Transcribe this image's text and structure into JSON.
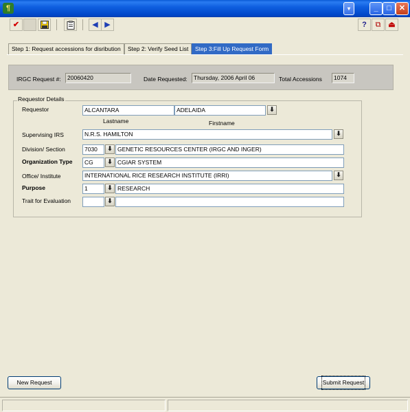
{
  "titlebar": {
    "app_icon": "rice-plant-icon",
    "buttons": {
      "system": "▾",
      "minimize": "_",
      "maximize": "□",
      "close": "✕"
    }
  },
  "toolbar": {
    "check": "✔",
    "save": "💾",
    "clipboard": "📋",
    "prev": "◀",
    "next": "▶",
    "help": "?",
    "copy": "⧉",
    "exit": "⏏"
  },
  "tabs": [
    {
      "label": "Step 1: Request accessions for disribution"
    },
    {
      "label": "Step 2: Verify Seed List"
    },
    {
      "label": "Step 3:Fill Up Request Form"
    }
  ],
  "header": {
    "request_label": "IRGC Request #:",
    "request_value": "20060420",
    "date_label": "Date Requested:",
    "date_value": "Thursday, 2006 April 06",
    "total_label": "Total Accessions",
    "total_value": "1074"
  },
  "requestor": {
    "group_title": "Requestor Details",
    "requestor_label": "Requestor",
    "lastname": "ALCANTARA",
    "firstname": "ADELAIDA",
    "lastname_label": "Lastname",
    "firstname_label": "Firstname",
    "irs_label": "Supervising IRS",
    "irs_value": "N.R.S. HAMILTON",
    "division_label": "Division/ Section",
    "division_code": "7030",
    "division_name": "GENETIC RESOURCES CENTER (IRGC AND INGER)",
    "orgtype_label": "Organization Type",
    "orgtype_code": "CG",
    "orgtype_name": "CGIAR SYSTEM",
    "office_label": "Office/ Institute",
    "office_value": "INTERNATIONAL RICE RESEARCH INSTITUTE (IRRI)",
    "purpose_label": "Purpose",
    "purpose_code": "1",
    "purpose_name": "RESEARCH",
    "trait_label": "Trait for Evaluation",
    "trait_code": "",
    "trait_name": ""
  },
  "footer": {
    "new_request": "New Request",
    "submit_request": "Submit Request"
  },
  "dropdown_glyph": "⬇"
}
